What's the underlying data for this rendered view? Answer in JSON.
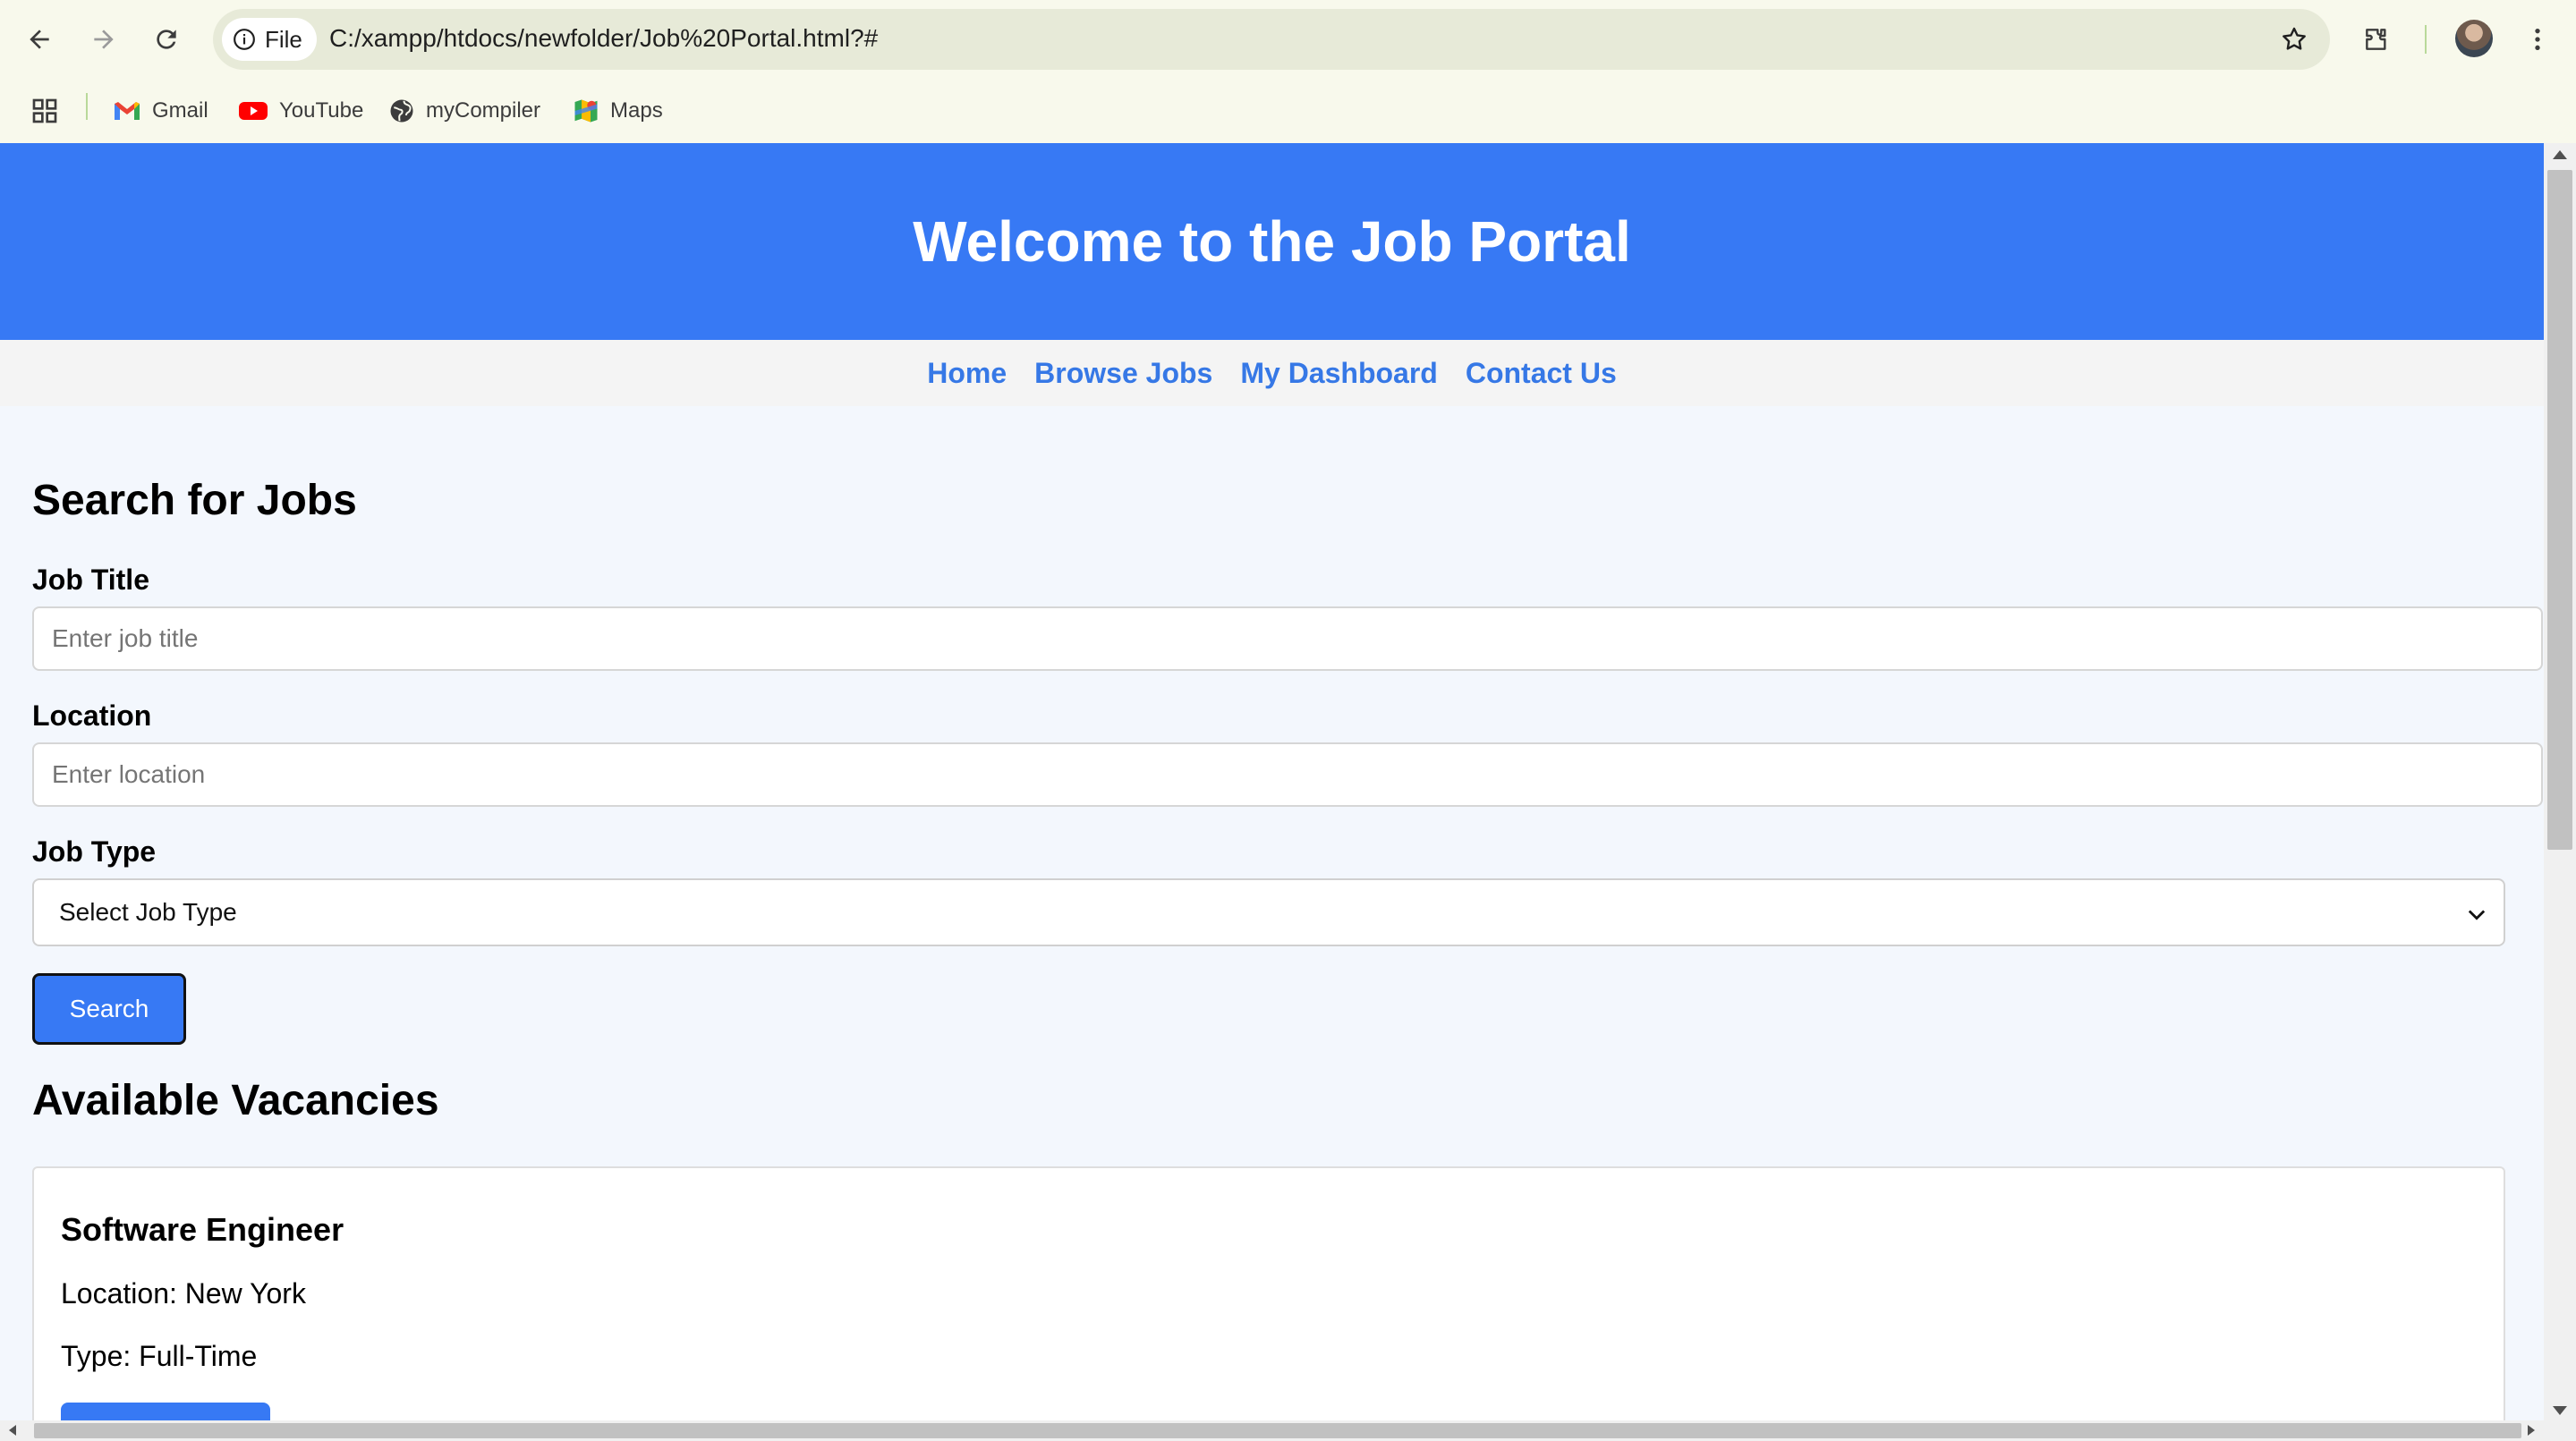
{
  "browser": {
    "file_chip_label": "File",
    "url": "C:/xampp/htdocs/newfolder/Job%20Portal.html?#",
    "bookmarks": [
      {
        "label": "Gmail",
        "icon": "gmail-icon"
      },
      {
        "label": "YouTube",
        "icon": "youtube-icon"
      },
      {
        "label": "myCompiler",
        "icon": "globe-icon"
      },
      {
        "label": "Maps",
        "icon": "maps-icon"
      }
    ]
  },
  "header": {
    "title": "Welcome to the Job Portal"
  },
  "nav": [
    {
      "label": "Home"
    },
    {
      "label": "Browse Jobs"
    },
    {
      "label": "My Dashboard"
    },
    {
      "label": "Contact Us"
    }
  ],
  "search": {
    "heading": "Search for Jobs",
    "job_title_label": "Job Title",
    "job_title_placeholder": "Enter job title",
    "location_label": "Location",
    "location_placeholder": "Enter location",
    "job_type_label": "Job Type",
    "job_type_selected": "Select Job Type",
    "button_label": "Search"
  },
  "vacancies": {
    "heading": "Available Vacancies",
    "items": [
      {
        "title": "Software Engineer",
        "location": "Location: New York",
        "type": "Type: Full-Time"
      }
    ]
  },
  "colors": {
    "brand": "#3779f4",
    "link": "#3678e6"
  }
}
